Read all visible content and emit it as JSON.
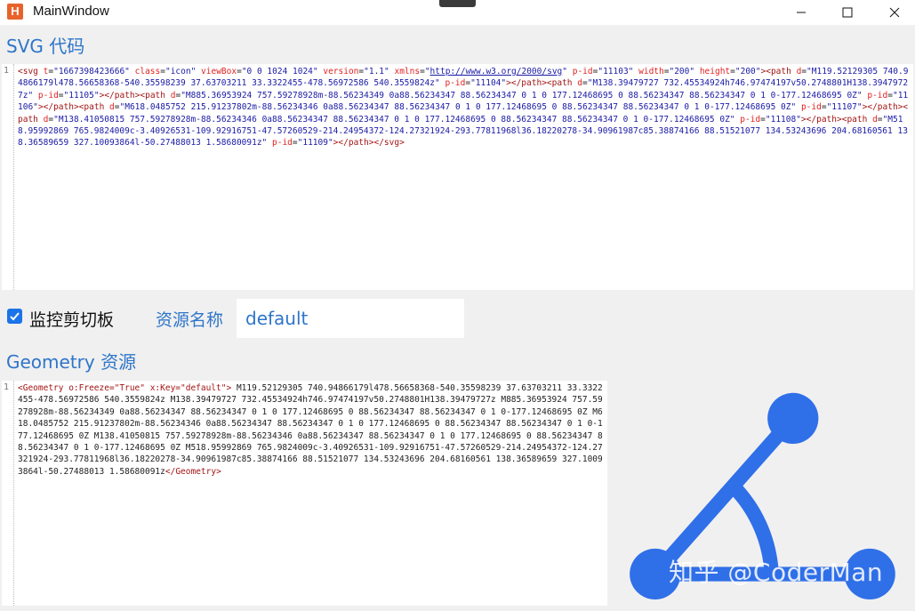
{
  "window": {
    "title": "MainWindow",
    "icon_letter": "H",
    "controls": {
      "minimize": "minimize-icon",
      "maximize": "maximize-icon",
      "close": "close-icon"
    }
  },
  "svg_section": {
    "heading": "SVG 代码",
    "line_number": "1",
    "code": "<svg t=\"1667398423666\" class=\"icon\" viewBox=\"0 0 1024 1024\" version=\"1.1\" xmlns=\"http://www.w3.org/2000/svg\" p-id=\"11103\" width=\"200\" height=\"200\"><path d=\"M119.52129305 740.94866179l478.56658368-540.35598239 37.63703211 33.3322455-478.56972586 540.3559824z\" p-id=\"11104\"></path><path d=\"M138.39479727 732.45534924h746.97474197v50.2748801H138.39479727z\" p-id=\"11105\"></path><path d=\"M885.36953924 757.59278928m-88.56234349 0a88.56234347 88.56234347 0 1 0 177.12468695 0 88.56234347 88.56234347 0 1 0-177.12468695 0Z\" p-id=\"11106\"></path><path d=\"M618.0485752 215.91237802m-88.56234346 0a88.56234347 88.56234347 0 1 0 177.12468695 0 88.56234347 88.56234347 0 1 0-177.12468695 0Z\" p-id=\"11107\"></path><path d=\"M138.41050815 757.59278928m-88.56234346 0a88.56234347 88.56234347 0 1 0 177.12468695 0 88.56234347 88.56234347 0 1 0-177.12468695 0Z\" p-id=\"11108\"></path><path d=\"M518.95992869 765.9824009c-3.40926531-109.92916751-47.57260529-214.24954372-124.27321924-293.77811968l36.18220278-34.90961987c85.38874166 88.51521077 134.53243696 204.68160561 138.36589659 327.10093864l-50.27488013 1.58680091z\" p-id=\"11109\"></path></svg>"
  },
  "controls": {
    "monitor_label": "监控剪切板",
    "monitor_checked": true,
    "resource_name_label": "资源名称",
    "resource_name_value": "default"
  },
  "geometry_section": {
    "heading": "Geometry 资源",
    "line_number": "1",
    "open_tag": "<Geometry o:Freeze=\"True\" x:Key=\"default\">",
    "body": " M119.52129305 740.94866179l478.56658368-540.35598239 37.63703211 33.3322455-478.56972586 540.3559824z M138.39479727 732.45534924h746.97474197v50.2748801H138.39479727z M885.36953924 757.59278928m-88.56234349 0a88.56234347 88.56234347 0 1 0 177.12468695 0 88.56234347 88.56234347 0 1 0-177.12468695 0Z M618.0485752 215.91237802m-88.56234346 0a88.56234347 88.56234347 0 1 0 177.12468695 0 88.56234347 88.56234347 0 1 0-177.12468695 0Z M138.41050815 757.59278928m-88.56234346 0a88.56234347 88.56234347 0 1 0 177.12468695 0 88.56234347 88.56234347 0 1 0-177.12468695 0Z M518.95992869 765.9824009c-3.40926531-109.92916751-47.57260529-214.24954372-124.27321924-293.77811968l36.18220278-34.90961987c85.38874166 88.51521077 134.53243696 204.68160561 138.36589659 327.10093864l-50.27488013 1.58680091z",
    "close_tag": "</Geometry>"
  },
  "preview": {
    "fill_color": "#2f6fe8",
    "watermark": "知乎 @CoderMan"
  },
  "colors": {
    "heading": "#2e75c9",
    "checkbox": "#1a73e8",
    "background": "#f0f0f0"
  }
}
